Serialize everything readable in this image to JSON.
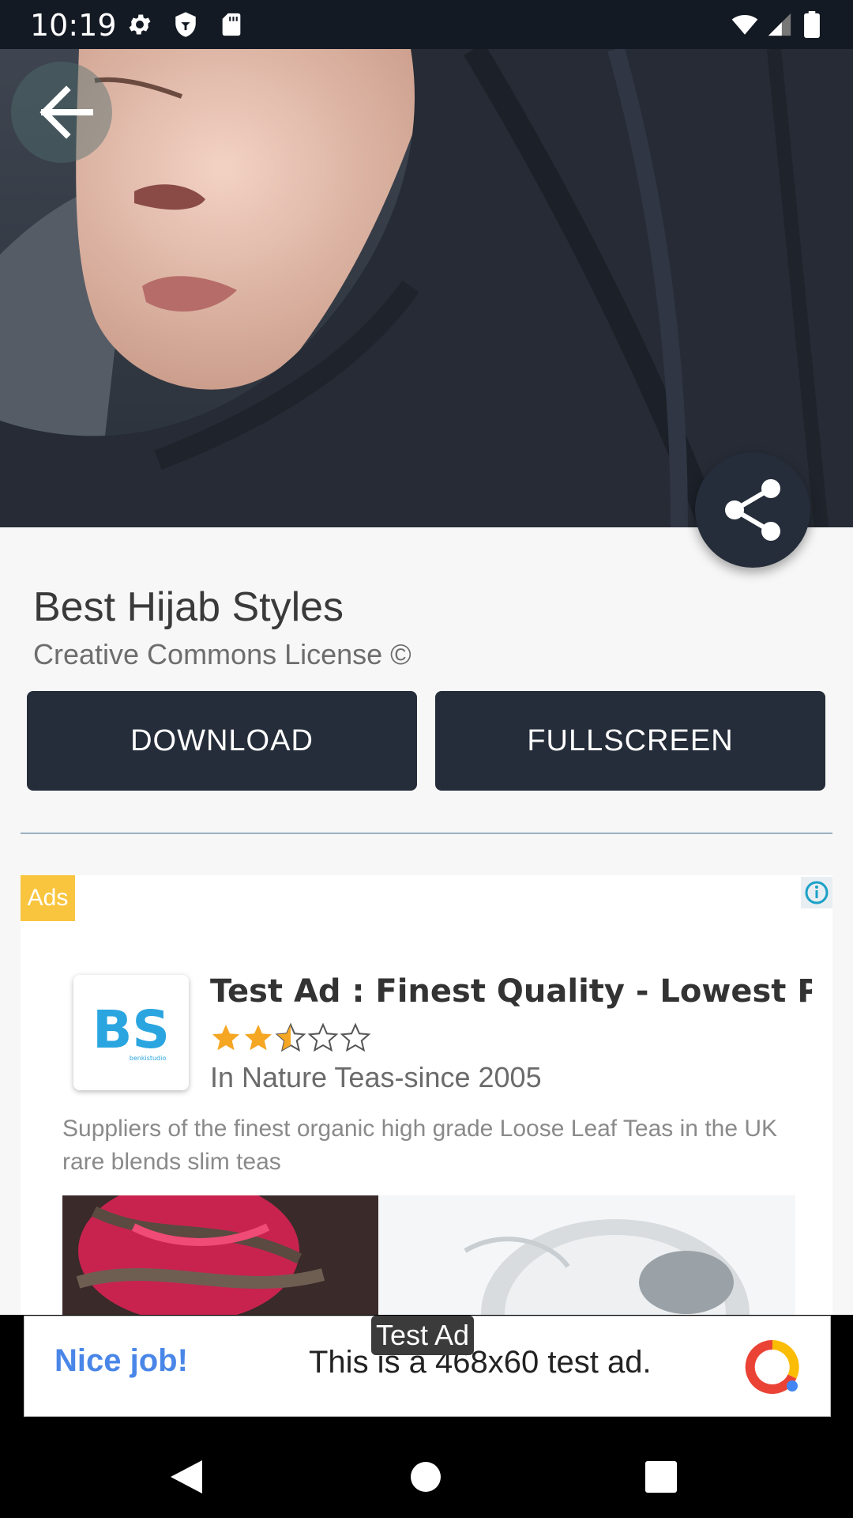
{
  "status_bar": {
    "time": "10:19",
    "icons": [
      "settings-icon",
      "shield-icon",
      "sd-card-icon",
      "wifi-icon",
      "signal-icon",
      "battery-icon"
    ]
  },
  "hero": {
    "icon_back": "back-arrow-icon",
    "icon_share": "share-icon"
  },
  "detail": {
    "title": "Best Hijab Styles",
    "license": "Creative Commons License ©",
    "download_label": "DOWNLOAD",
    "fullscreen_label": "FULLSCREEN"
  },
  "ad_card": {
    "badge": "Ads",
    "title": "Test Ad : Finest Quality - Lowest Pri",
    "rating": 2.5,
    "rating_max": 5,
    "advertiser": "In Nature Teas-since 2005",
    "body": "Suppliers of the finest organic high grade Loose Leaf Teas in the UK rare blends slim teas"
  },
  "banner_ad": {
    "label": "Test Ad",
    "left_text": "Nice job!",
    "main_text": "This is a 468x60 test ad."
  },
  "colors": {
    "primary": "#252d3a",
    "ads_badge": "#f9c53f",
    "star": "#f5a623",
    "link_blue": "#4a86e8"
  }
}
